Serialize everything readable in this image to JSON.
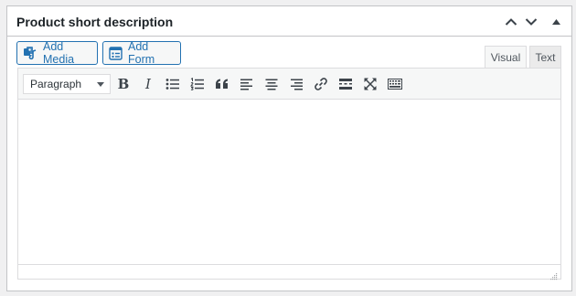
{
  "panel": {
    "title": "Product short description",
    "controls": [
      "chevron-up-icon",
      "chevron-down-icon",
      "triangle-up-icon"
    ]
  },
  "media_buttons": {
    "add_media": "Add Media",
    "add_form": "Add Form"
  },
  "editor_tabs": {
    "visual": "Visual",
    "text": "Text",
    "active": "visual"
  },
  "toolbar": {
    "format_selected": "Paragraph",
    "buttons": [
      "bold",
      "italic",
      "bulleted-list",
      "numbered-list",
      "blockquote",
      "align-left",
      "align-center",
      "align-right",
      "insert-link",
      "read-more",
      "fullscreen",
      "toolbar-toggle"
    ],
    "bold_glyph": "B",
    "italic_glyph": "I"
  },
  "content": {
    "value": ""
  },
  "colors": {
    "accent": "#2271b1",
    "border": "#c3c4c7",
    "toolbar_bg": "#f6f7f7"
  }
}
